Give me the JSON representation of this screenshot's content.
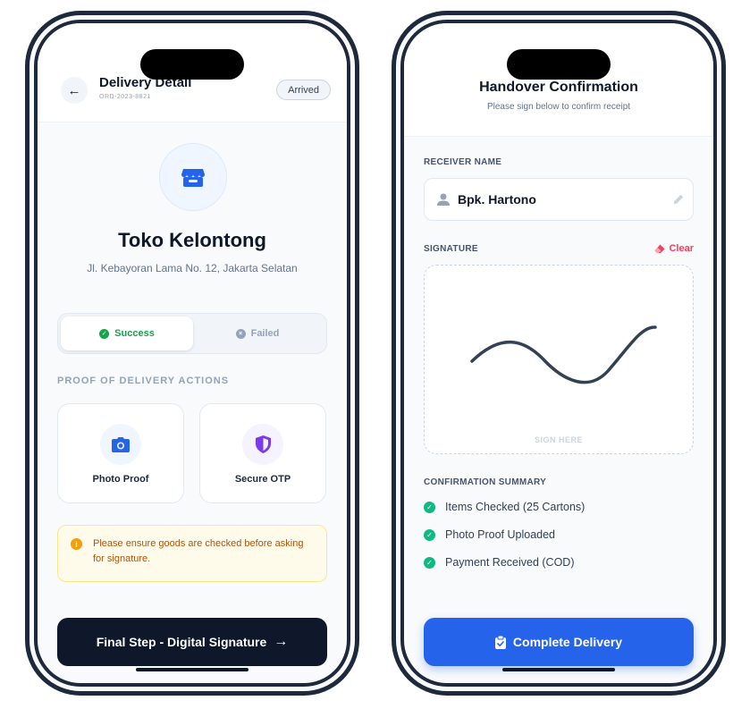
{
  "colors": {
    "primary": "#2563eb",
    "dark": "#0f172a",
    "success": "#16a34a",
    "warning": "#f59e0b",
    "danger": "#f43f5e",
    "otp_purple": "#7c3aed"
  },
  "left": {
    "header": {
      "title": "Delivery Detail",
      "order_id": "ORD-2023-8821",
      "status": "Arrived",
      "back_icon": "arrow-left-icon"
    },
    "store": {
      "icon": "store-icon",
      "name": "Toko Kelontong",
      "address": "Jl. Kebayoran Lama No. 12, Jakarta Selatan"
    },
    "toggle": {
      "success_label": "Success",
      "failed_label": "Failed",
      "selected": "Success"
    },
    "section_label": "PROOF OF DELIVERY ACTIONS",
    "actions": [
      {
        "label": "Photo Proof",
        "icon": "camera-icon"
      },
      {
        "label": "Secure OTP",
        "icon": "shield-icon"
      }
    ],
    "warning": {
      "icon": "info-icon",
      "text": "Please ensure goods are checked before asking for signature."
    },
    "final_button": {
      "label": "Final Step - Digital Signature",
      "icon": "arrow-right-icon"
    }
  },
  "right": {
    "header": {
      "title": "Handover Confirmation",
      "subtitle": "Please sign below to confirm receipt"
    },
    "receiver": {
      "label": "RECEIVER NAME",
      "value": "Bpk. Hartono",
      "icon": "user-icon",
      "edit_icon": "pencil-icon"
    },
    "signature": {
      "label": "SIGNATURE",
      "clear_label": "Clear",
      "clear_icon": "eraser-icon",
      "hint": "SIGN HERE"
    },
    "summary": {
      "label": "CONFIRMATION SUMMARY",
      "items": [
        "Items Checked (25 Cartons)",
        "Photo Proof Uploaded",
        "Payment Received (COD)"
      ]
    },
    "complete_button": {
      "label": "Complete Delivery",
      "icon": "clipboard-check-icon"
    }
  }
}
